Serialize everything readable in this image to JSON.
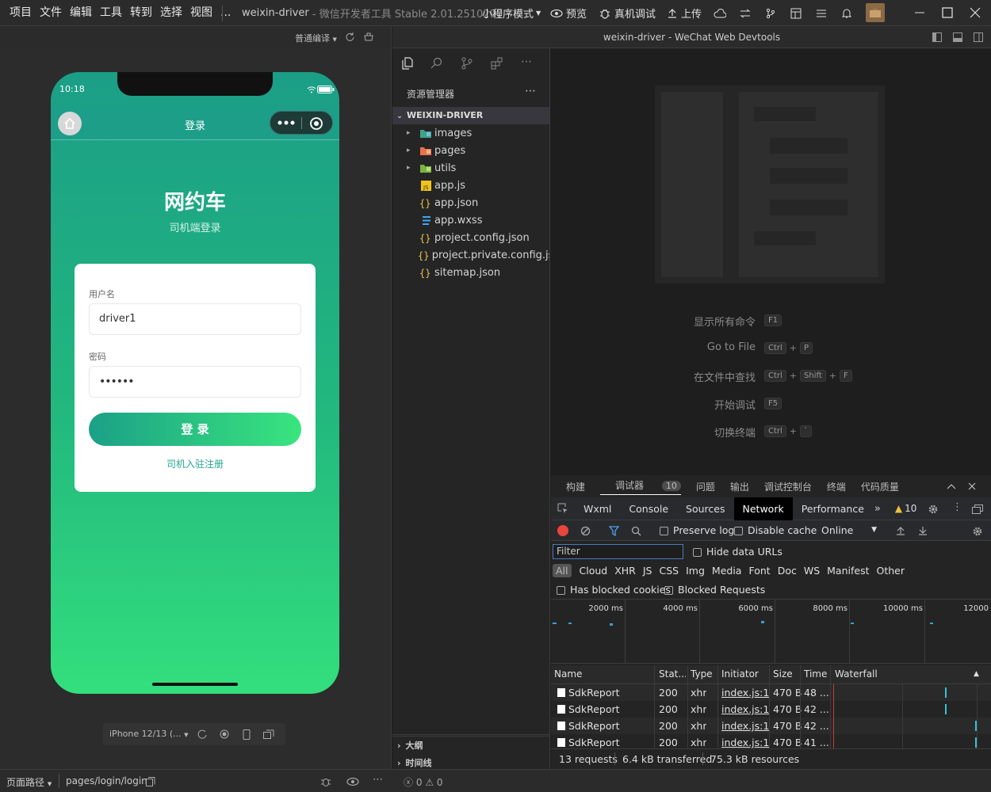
{
  "menubar": {
    "items": [
      "项目",
      "文件",
      "编辑",
      "工具",
      "转到",
      "选择",
      "视图",
      "..."
    ],
    "title": "weixin-driver",
    "subtitle": "- 微信开发者工具 Stable 2.01.2510290",
    "mode": "小程序模式",
    "preview": "预览",
    "device_debug": "真机调试",
    "upload": "上传"
  },
  "sim": {
    "compile_mode": "普通编译",
    "time": "10:18",
    "nav_title": "登录",
    "app_title": "网约车",
    "app_subtitle": "司机端登录",
    "username_label": "用户名",
    "username_value": "driver1",
    "password_label": "密码",
    "password_value": "••••••",
    "login_button": "登 录",
    "register_link": "司机入驻注册",
    "device": "iPhone 12/13 (...",
    "colors": {
      "grad_top": "#1b9e86",
      "grad_bottom": "#33df7d"
    }
  },
  "explorer": {
    "title": "资源管理器",
    "root": "WEIXIN-DRIVER",
    "items": [
      {
        "name": "images",
        "icon": "folder-images-icon",
        "folder": true
      },
      {
        "name": "pages",
        "icon": "folder-pages-icon",
        "folder": true
      },
      {
        "name": "utils",
        "icon": "folder-utils-icon",
        "folder": true
      },
      {
        "name": "app.js",
        "icon": "js-file-icon",
        "folder": false
      },
      {
        "name": "app.json",
        "icon": "json-file-icon",
        "folder": false
      },
      {
        "name": "app.wxss",
        "icon": "wxss-file-icon",
        "folder": false
      },
      {
        "name": "project.config.json",
        "icon": "json-file-icon",
        "folder": false
      },
      {
        "name": "project.private.config.js...",
        "icon": "json-file-icon",
        "folder": false
      },
      {
        "name": "sitemap.json",
        "icon": "json-file-icon",
        "folder": false
      }
    ],
    "outline": "大纲",
    "timeline": "时间线"
  },
  "editor": {
    "window_title": "weixin-driver - WeChat Web Devtools",
    "commands": [
      {
        "label": "显示所有命令",
        "keys": [
          "F1"
        ]
      },
      {
        "label": "Go to File",
        "keys": [
          "Ctrl",
          "+",
          "P"
        ]
      },
      {
        "label": "在文件中查找",
        "keys": [
          "Ctrl",
          "+",
          "Shift",
          "+",
          "F"
        ]
      },
      {
        "label": "开始调试",
        "keys": [
          "F5"
        ]
      },
      {
        "label": "切换终端",
        "keys": [
          "Ctrl",
          "+",
          "`"
        ]
      }
    ]
  },
  "devtools": {
    "panel_tabs": [
      "构建",
      "调试器",
      "问题",
      "输出",
      "调试控制台",
      "终端",
      "代码质量"
    ],
    "debugger_badge": "10",
    "tabs": [
      "Wxml",
      "Console",
      "Sources",
      "Network",
      "Performance"
    ],
    "warnings": "10",
    "preserve_log": "Preserve log",
    "disable_cache": "Disable cache",
    "throttle": "Online",
    "filter_placeholder": "Filter",
    "hide_data_urls": "Hide data URLs",
    "filter_types": [
      "All",
      "Cloud",
      "XHR",
      "JS",
      "CSS",
      "Img",
      "Media",
      "Font",
      "Doc",
      "WS",
      "Manifest",
      "Other"
    ],
    "has_blocked_cookies": "Has blocked cookies",
    "blocked_requests": "Blocked Requests",
    "ticks": [
      "2000 ms",
      "4000 ms",
      "6000 ms",
      "8000 ms",
      "10000 ms",
      "12000"
    ],
    "columns": [
      "Name",
      "Stat...",
      "Type",
      "Initiator",
      "Size",
      "Time",
      "Waterfall"
    ],
    "rows": [
      {
        "name": "SdkReport",
        "status": "200",
        "type": "xhr",
        "initiator": "index.js:1",
        "size": "470 B",
        "time": "48 ..."
      },
      {
        "name": "SdkReport",
        "status": "200",
        "type": "xhr",
        "initiator": "index.js:1",
        "size": "470 B",
        "time": "42 ..."
      },
      {
        "name": "SdkReport",
        "status": "200",
        "type": "xhr",
        "initiator": "index.js:1",
        "size": "470 B",
        "time": "42 ..."
      },
      {
        "name": "SdkReport",
        "status": "200",
        "type": "xhr",
        "initiator": "index.js:1",
        "size": "470 B",
        "time": "41 ..."
      }
    ],
    "requests": "13 requests",
    "transferred": "6.4 kB transferred",
    "resources": "75.3 kB resources"
  },
  "statusbar": {
    "page_path_label": "页面路径",
    "page_path": "pages/login/login",
    "errors": "0",
    "warnings": "0"
  }
}
